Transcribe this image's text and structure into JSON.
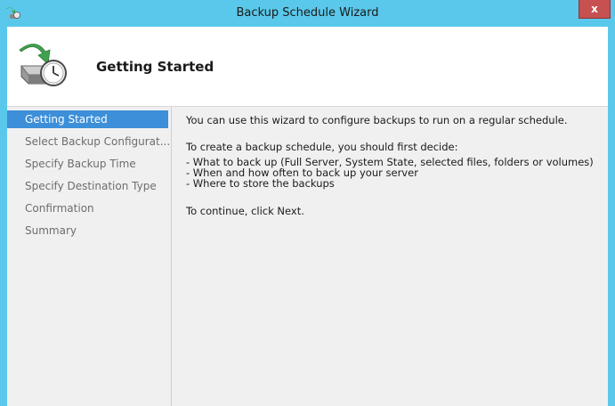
{
  "window": {
    "title": "Backup Schedule Wizard",
    "close_label": "x",
    "accent_color": "#5ac8ea",
    "selected_color": "#3c8fd8"
  },
  "header": {
    "title": "Getting Started",
    "icon": "backup-schedule-icon"
  },
  "nav": {
    "items": [
      {
        "label": "Getting Started",
        "selected": true
      },
      {
        "label": "Select Backup Configurat...",
        "selected": false
      },
      {
        "label": "Specify Backup Time",
        "selected": false
      },
      {
        "label": "Specify Destination Type",
        "selected": false
      },
      {
        "label": "Confirmation",
        "selected": false
      },
      {
        "label": "Summary",
        "selected": false
      }
    ]
  },
  "content": {
    "intro": "You can use this wizard to configure backups to run on a regular schedule.",
    "decide_heading": "To create a backup schedule, you should first decide:",
    "bullets": [
      "-  What to back up (Full Server, System State, selected files, folders or volumes)",
      "-  When and how often to back up your server",
      "-  Where to store the backups"
    ],
    "continue_text": "To continue, click Next."
  }
}
